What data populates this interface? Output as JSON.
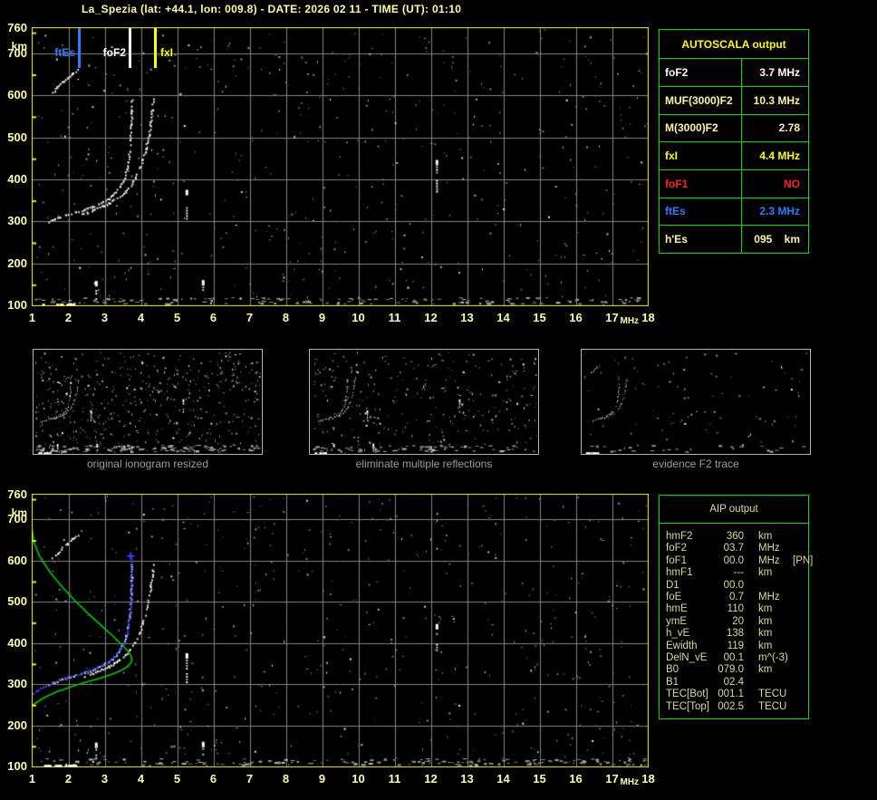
{
  "title": "La_Spezia (lat: +44.1, lon: 009.8) - DATE: 2026 02 11 - TIME (UT): 01:10",
  "colors": {
    "background": "#000000",
    "plot_border": "#ededed00_unused",
    "border_yellow": "#ecec00",
    "grid_gray": "#848484",
    "tick_label": "#ffffa6",
    "table_border_green": "#00dc00",
    "autoscala_header_yellow": "#ffff00",
    "aip_text": "#d9dc8e",
    "caption_gray": "#9c9c9c",
    "trace_white": "#ffffff",
    "profile_green": "#00c800",
    "restored_blue": "#3344ff"
  },
  "autoscala_table": {
    "header": "AUTOSCALA output",
    "rows": [
      {
        "label": "foF2",
        "value": "3.7 MHz",
        "color": "#ffffff"
      },
      {
        "label": "MUF(3000)F2",
        "value": "10.3 MHz",
        "color": "#f8f8a4"
      },
      {
        "label": "M(3000)F2",
        "value": "2.78",
        "color": "#f8f8a4"
      },
      {
        "label": "fxI",
        "value": "4.4 MHz",
        "color": "#ffff00"
      },
      {
        "label": "foF1",
        "value": "NO",
        "color": "#ff2222"
      },
      {
        "label": "ftEs",
        "value": "2.3 MHz",
        "color": "#2b7cff"
      },
      {
        "label": "h'Es",
        "value": "095    km",
        "color": "#f8f8a4"
      }
    ]
  },
  "aip_table": {
    "header": "AIP output",
    "rows": [
      {
        "label": "hmF2",
        "value": "360",
        "unit": "km",
        "extra": ""
      },
      {
        "label": "foF2",
        "value": "03.7",
        "unit": "MHz",
        "extra": ""
      },
      {
        "label": "foF1",
        "value": "00.0",
        "unit": "MHz",
        "extra": "[PN]"
      },
      {
        "label": "hmF1",
        "value": "---",
        "unit": "km",
        "extra": ""
      },
      {
        "label": "D1",
        "value": "00.0",
        "unit": "",
        "extra": ""
      },
      {
        "label": "foE",
        "value": "0.7",
        "unit": "MHz",
        "extra": ""
      },
      {
        "label": "hmE",
        "value": "110",
        "unit": "km",
        "extra": ""
      },
      {
        "label": "ymE",
        "value": "20",
        "unit": "km",
        "extra": ""
      },
      {
        "label": "h_vE",
        "value": "138",
        "unit": "km",
        "extra": ""
      },
      {
        "label": "Ewidth",
        "value": "119",
        "unit": "km",
        "extra": ""
      },
      {
        "label": "DelN_vE",
        "value": "00.1",
        "unit": "m^(-3)",
        "extra": ""
      },
      {
        "label": "B0",
        "value": "079.0",
        "unit": "km",
        "extra": ""
      },
      {
        "label": "B1",
        "value": "02.4",
        "unit": "",
        "extra": ""
      },
      {
        "label": "TEC[Bot]",
        "value": "001.1",
        "unit": "TECU",
        "extra": ""
      },
      {
        "label": "TEC[Top]",
        "value": "002.5",
        "unit": "TECU",
        "extra": ""
      }
    ]
  },
  "thumbnails": {
    "captions": [
      "original ionogram resized",
      "eliminate multiple reflections",
      "evidence F2 trace"
    ]
  },
  "chart_data": {
    "type": "scatter",
    "description": "Vertical-incidence ionograms: virtual height (km) vs sounding frequency (MHz)",
    "x_label": "MHz",
    "y_unit": "km",
    "x_range": [
      1,
      18
    ],
    "y_range": [
      100,
      760
    ],
    "x_ticks": [
      1,
      2,
      3,
      4,
      5,
      6,
      7,
      8,
      9,
      10,
      11,
      12,
      13,
      14,
      15,
      16,
      17,
      18
    ],
    "y_ticks": [
      100,
      200,
      300,
      400,
      500,
      600,
      700,
      760
    ],
    "grid": {
      "x_step_mhz": 1,
      "y_step_km": 100,
      "grid_on": true
    },
    "panels": [
      {
        "id": "autoscala_ionogram",
        "markers": [
          {
            "label": "ftEs",
            "freq_mhz": 2.3,
            "color": "#2b7cff",
            "side": "left"
          },
          {
            "label": "foF2",
            "freq_mhz": 3.7,
            "color": "#ffffff",
            "side": "left"
          },
          {
            "label": "fxI",
            "freq_mhz": 4.4,
            "color": "#ffff00",
            "side": "right"
          }
        ]
      },
      {
        "id": "aip_ionogram",
        "overlays": [
          "electron_density_profile",
          "restored_trace",
          "restored_trace_peak_marker"
        ]
      }
    ],
    "traces": {
      "f2_ordinary": [
        [
          1.45,
          300
        ],
        [
          1.6,
          306
        ],
        [
          1.75,
          311
        ],
        [
          1.9,
          315
        ],
        [
          2.05,
          319
        ],
        [
          2.2,
          323
        ],
        [
          2.35,
          327
        ],
        [
          2.5,
          331
        ],
        [
          2.65,
          336
        ],
        [
          2.8,
          342
        ],
        [
          2.95,
          348
        ],
        [
          3.1,
          356
        ],
        [
          3.2,
          363
        ],
        [
          3.3,
          372
        ],
        [
          3.4,
          384
        ],
        [
          3.5,
          400
        ],
        [
          3.57,
          418
        ],
        [
          3.63,
          441
        ],
        [
          3.67,
          466
        ],
        [
          3.7,
          496
        ],
        [
          3.72,
          530
        ],
        [
          3.73,
          562
        ],
        [
          3.74,
          592
        ]
      ],
      "f2_extraordinary": [
        [
          2.35,
          318
        ],
        [
          2.5,
          322
        ],
        [
          2.65,
          327
        ],
        [
          2.8,
          332
        ],
        [
          2.95,
          338
        ],
        [
          3.1,
          344
        ],
        [
          3.25,
          352
        ],
        [
          3.4,
          361
        ],
        [
          3.55,
          372
        ],
        [
          3.7,
          386
        ],
        [
          3.82,
          403
        ],
        [
          3.93,
          423
        ],
        [
          4.03,
          447
        ],
        [
          4.12,
          474
        ],
        [
          4.2,
          505
        ],
        [
          4.26,
          538
        ],
        [
          4.3,
          568
        ],
        [
          4.33,
          592
        ]
      ],
      "multiple_reflection": [
        [
          1.55,
          608
        ],
        [
          1.68,
          620
        ],
        [
          1.82,
          632
        ],
        [
          1.96,
          643
        ],
        [
          2.1,
          653
        ],
        [
          2.24,
          662
        ]
      ],
      "es_layer": {
        "km": 104,
        "segments_mhz": [
          [
            1.28,
            1.52
          ],
          [
            1.62,
            1.8
          ],
          [
            1.9,
            2.2
          ]
        ]
      },
      "interference_streaks": [
        {
          "freq_mhz": 2.77,
          "km": [
            112,
            158
          ]
        },
        {
          "freq_mhz": 5.27,
          "km": [
            305,
            375
          ]
        },
        {
          "freq_mhz": 5.72,
          "km": [
            112,
            160
          ]
        },
        {
          "freq_mhz": 12.17,
          "km": [
            363,
            446
          ]
        }
      ],
      "electron_density_profile": [
        [
          1.0,
          248
        ],
        [
          1.3,
          266
        ],
        [
          1.7,
          282
        ],
        [
          2.1,
          294
        ],
        [
          2.5,
          305
        ],
        [
          2.9,
          315
        ],
        [
          3.2,
          324
        ],
        [
          3.45,
          333
        ],
        [
          3.62,
          342
        ],
        [
          3.72,
          351
        ],
        [
          3.75,
          360
        ],
        [
          3.72,
          370
        ],
        [
          3.62,
          382
        ],
        [
          3.45,
          398
        ],
        [
          3.2,
          419
        ],
        [
          2.9,
          443
        ],
        [
          2.55,
          471
        ],
        [
          2.2,
          501
        ],
        [
          1.85,
          534
        ],
        [
          1.5,
          571
        ],
        [
          1.2,
          611
        ],
        [
          1.05,
          645
        ],
        [
          1.0,
          676
        ]
      ],
      "restored_trace": [
        [
          1.03,
          279
        ],
        [
          1.15,
          287
        ],
        [
          1.3,
          294
        ],
        [
          1.45,
          301
        ],
        [
          1.6,
          308
        ],
        [
          1.75,
          312
        ],
        [
          1.9,
          316
        ],
        [
          2.05,
          320
        ],
        [
          2.2,
          324
        ],
        [
          2.35,
          328
        ],
        [
          2.5,
          332
        ],
        [
          2.65,
          337
        ],
        [
          2.8,
          343
        ],
        [
          2.95,
          349
        ],
        [
          3.1,
          357
        ],
        [
          3.2,
          364
        ],
        [
          3.3,
          374
        ],
        [
          3.42,
          387
        ],
        [
          3.52,
          403
        ],
        [
          3.6,
          423
        ],
        [
          3.65,
          447
        ],
        [
          3.69,
          476
        ],
        [
          3.71,
          509
        ],
        [
          3.72,
          544
        ],
        [
          3.73,
          577
        ],
        [
          3.735,
          605
        ]
      ],
      "restored_trace_peak_marker": {
        "freq_mhz": 3.72,
        "km": 611
      }
    }
  }
}
